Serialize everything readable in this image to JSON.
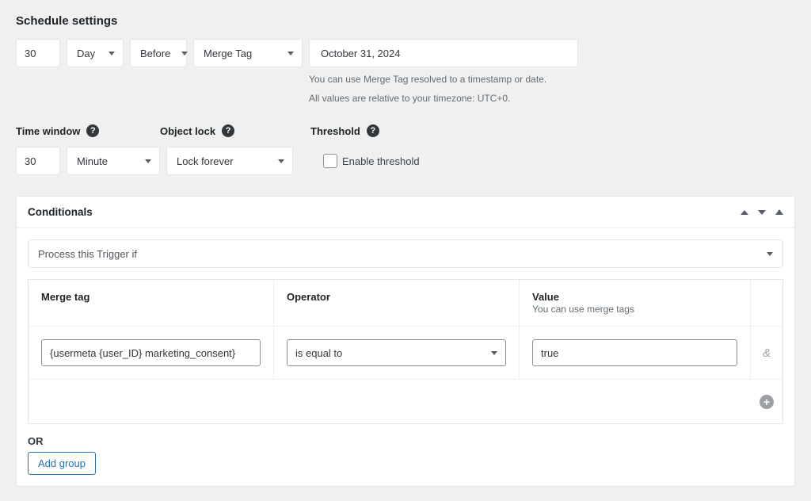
{
  "title": "Schedule settings",
  "schedule": {
    "offset_value": "30",
    "offset_unit": "Day",
    "direction": "Before",
    "mode": "Merge Tag",
    "date": "October 31, 2024",
    "hint1": "You can use Merge Tag resolved to a timestamp or date.",
    "hint2": "All values are relative to your timezone: UTC+0."
  },
  "labels": {
    "time_window": "Time window",
    "object_lock": "Object lock",
    "threshold": "Threshold"
  },
  "time_window": {
    "value": "30",
    "unit": "Minute"
  },
  "object_lock": {
    "selected": "Lock forever"
  },
  "threshold": {
    "enable_label": "Enable threshold"
  },
  "conditionals": {
    "title": "Conditionals",
    "mode": "Process this Trigger if",
    "headers": {
      "merge_tag": "Merge tag",
      "operator": "Operator",
      "value": "Value",
      "value_sub": "You can use merge tags"
    },
    "row": {
      "merge_tag": "{usermeta {user_ID} marketing_consent}",
      "operator": "is equal to",
      "value": "true"
    },
    "join": "&",
    "or_label": "OR",
    "add_group": "Add group"
  }
}
